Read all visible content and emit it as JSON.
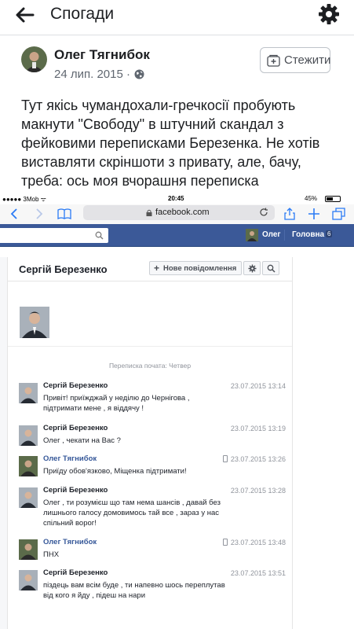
{
  "header": {
    "title": "Спогади"
  },
  "post": {
    "author": "Олег Тягнибок",
    "date": "24 лип. 2015 ·",
    "follow_label": "Стежити",
    "text_lines": [
      "Тут якісь чумандохали-гречкосії пробують",
      "макнути \"Свободу\" в штучний скандал з",
      "фейковими переписками Березенка. Не хотів",
      "виставляти скріншоти з привату, але, бачу,",
      "треба: ось моя вчорашня переписка"
    ]
  },
  "screenshot": {
    "status": {
      "carrier": "●●●●● 3Mob ᯤ",
      "time": "20:45",
      "battery": "45%"
    },
    "safari": {
      "url": "facebook.com"
    },
    "fb_bar": {
      "user": "Олег",
      "home": "Головна",
      "home_count": "6"
    },
    "conversation": {
      "title": "Сергій Березенко",
      "new_message_label": "Нове повідомлення",
      "started": "Переписка почата: Четвер",
      "messages": [
        {
          "name": "Сергій Березенко",
          "time": "23.07.2015 13:14",
          "lines": [
            "Привіт! приїжджай у неділю до Чернігова ,",
            "підтримати мене , я віддячу !"
          ]
        },
        {
          "name": "Сергій Березенко",
          "time": "23.07.2015 13:19",
          "lines": [
            "Олег , чекати на Вас ?"
          ]
        },
        {
          "name": "Олег Тягнибок",
          "time": "23.07.2015 13:26",
          "lines": [
            "Приїду обов'язково, Міщенка підтримати!"
          ]
        },
        {
          "name": "Сергій Березенко",
          "time": "23.07.2015 13:28",
          "lines": [
            "Олег , ти розумієш що там нема шансів , давай без",
            "лишнього галосу домовимось тай все , зараз у нас",
            "спільний ворог!"
          ]
        },
        {
          "name": "Олег Тягнибок",
          "time": "23.07.2015 13:48",
          "lines": [
            "ПНХ"
          ]
        },
        {
          "name": "Сергій Березенко",
          "time": "23.07.2015 13:51",
          "lines": [
            "піздець вам всім буде , ти напевно шось переплутав",
            "від кого я йду , підеш на нари"
          ]
        }
      ]
    }
  }
}
